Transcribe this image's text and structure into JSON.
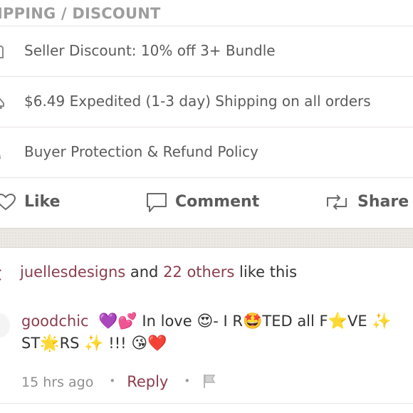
{
  "section": {
    "title": "IPPING / DISCOUNT"
  },
  "policies": [
    {
      "label": "Seller Discount: 10% off 3+ Bundle",
      "icon": "tag-icon"
    },
    {
      "label": "$6.49 Expedited (1-3 day) Shipping on all orders",
      "icon": "truck-icon"
    },
    {
      "label": "Buyer Protection & Refund Policy",
      "icon": "shield-icon"
    }
  ],
  "actions": {
    "like": "Like",
    "comment": "Comment",
    "share": "Share"
  },
  "likes": {
    "user": "juellesdesigns",
    "and": " and ",
    "others": "22 others",
    "suffix": " like this"
  },
  "comment": {
    "username": "goodchic",
    "text_parts": {
      "e1": "💜💕",
      "t1": " In love ",
      "e2": "😍",
      "t2": "- I R",
      "e3": "🤩",
      "t3": "TED all F",
      "e4": "⭐",
      "t4": "VE ",
      "e5": "✨",
      "t5": " ST",
      "e6": "🌟",
      "t6": "RS ",
      "e7": "✨",
      "t7": " !!! ",
      "e8": "😘❤️"
    },
    "time": "15 hrs ago",
    "reply": "Reply",
    "dot": "•"
  },
  "colors": {
    "accent": "#8b3e4d",
    "text": "#5b5b5b",
    "muted": "#9d9d9d",
    "band": "#ece9e4"
  }
}
